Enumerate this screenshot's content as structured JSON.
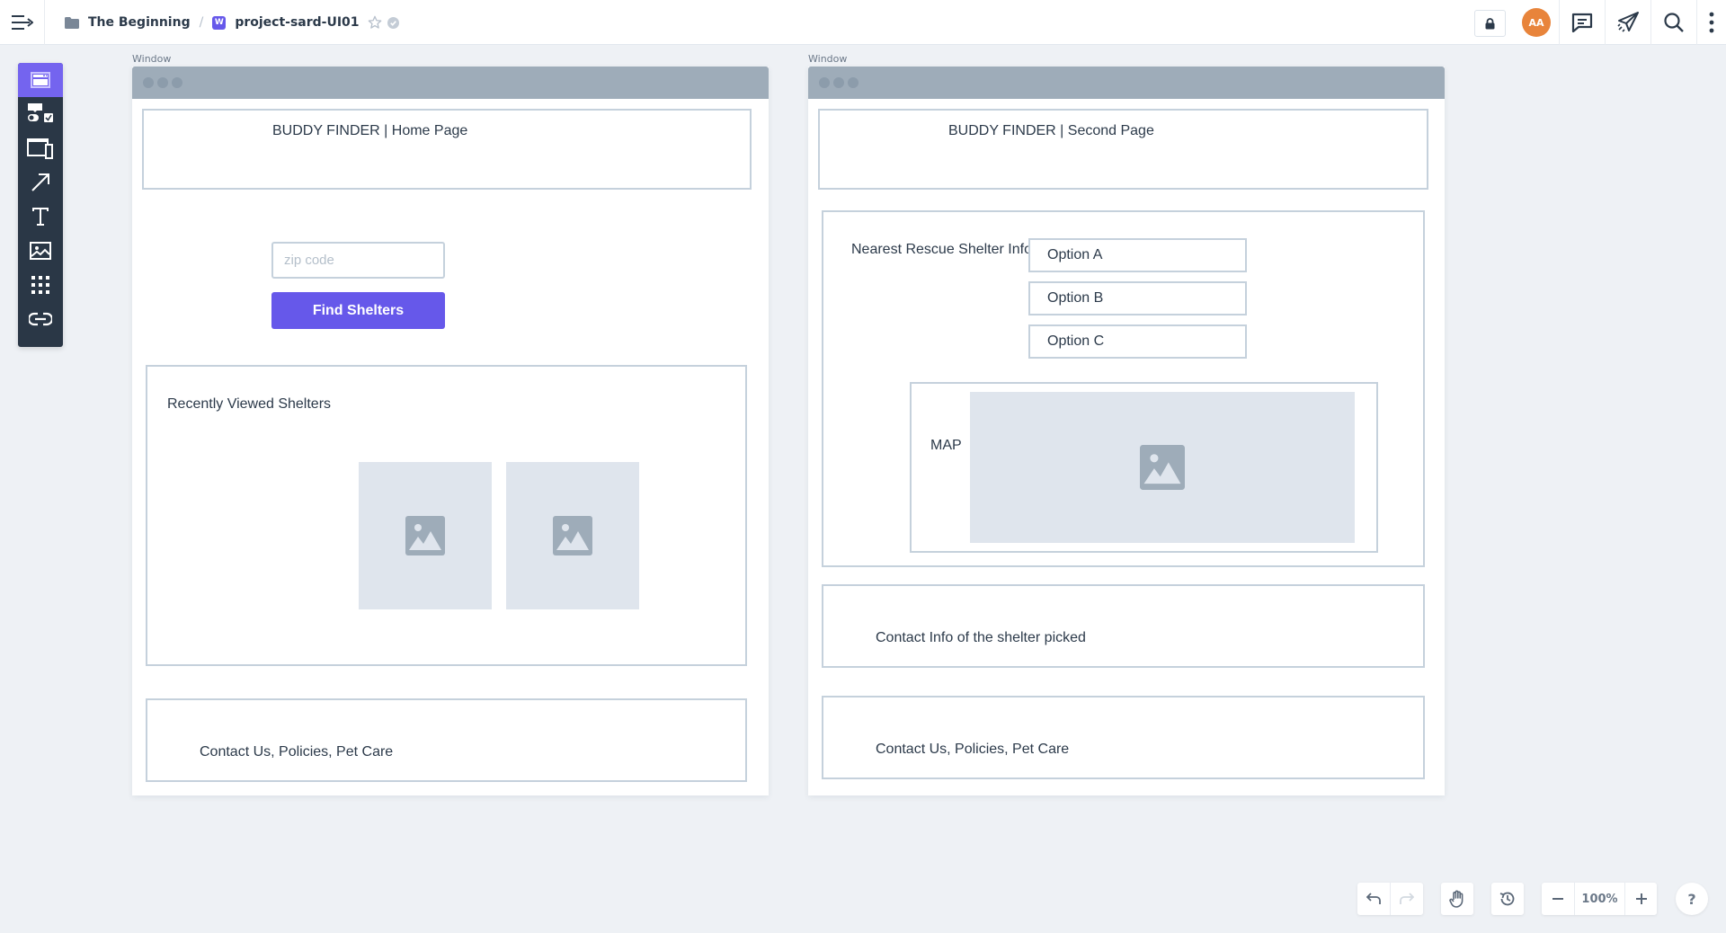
{
  "header": {
    "breadcrumb": [
      {
        "label": "The Beginning",
        "icon": "folder-icon"
      },
      {
        "label": "project-sard-UI01",
        "icon": "wireframe-badge-icon",
        "badge": "W"
      }
    ],
    "separator": "/",
    "avatar_initials": "AA",
    "avatar_color": "#e8843b",
    "icons": [
      "menu-icon",
      "star-icon",
      "verified-check-icon",
      "lock-icon",
      "comment-icon",
      "send-icon",
      "search-icon",
      "more-vertical-icon"
    ]
  },
  "palette": {
    "tools": [
      {
        "name": "window-tool",
        "active": true
      },
      {
        "name": "form-elements-tool",
        "active": false
      },
      {
        "name": "devices-tool",
        "active": false
      },
      {
        "name": "arrow-tool",
        "active": false
      },
      {
        "name": "text-tool",
        "active": false
      },
      {
        "name": "image-tool",
        "active": false
      },
      {
        "name": "grid-tool",
        "active": false
      },
      {
        "name": "link-tool",
        "active": false
      }
    ],
    "accent": "#7464ef"
  },
  "windows": [
    {
      "label": "Window",
      "title": "BUDDY FINDER | Home Page",
      "zip_placeholder": "zip code",
      "zip_value": "",
      "find_button": "Find Shelters",
      "recent_heading": "Recently Viewed Shelters",
      "footer": "Contact Us, Policies, Pet Care"
    },
    {
      "label": "Window",
      "title": "BUDDY FINDER | Second Page",
      "shelter_label": "Nearest Rescue Shelter Info:",
      "options": [
        "Option A",
        "Option B",
        "Option C"
      ],
      "map_label": "MAP",
      "contact_info": "Contact Info of the shelter picked",
      "footer": "Contact Us, Policies, Pet Care"
    }
  ],
  "bottom_toolbar": {
    "zoom_level": "100%",
    "help_label": "?"
  },
  "colors": {
    "primary_button": "#6658ea",
    "canvas_bg": "#eef1f5",
    "wire_border": "#c5d1dc",
    "titlebar": "#9eacb9"
  }
}
